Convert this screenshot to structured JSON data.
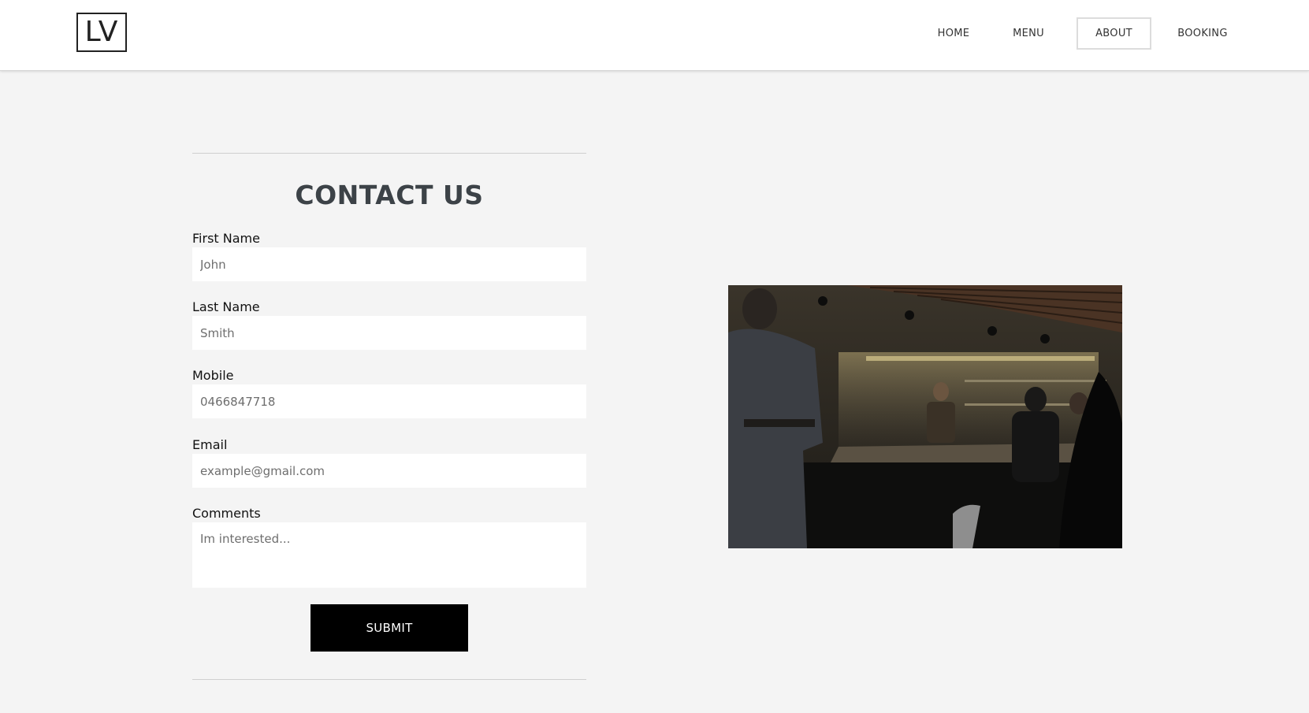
{
  "header": {
    "logo_text": "LV",
    "nav": [
      {
        "label": "HOME",
        "active": false
      },
      {
        "label": "MENU",
        "active": false
      },
      {
        "label": "ABOUT",
        "active": true
      },
      {
        "label": "BOOKING",
        "active": false
      }
    ]
  },
  "contact": {
    "title": "CONTACT US",
    "fields": [
      {
        "label": "First Name",
        "placeholder": "John",
        "value": ""
      },
      {
        "label": "Last Name",
        "placeholder": "Smith",
        "value": ""
      },
      {
        "label": "Mobile",
        "placeholder": "0466847718",
        "value": ""
      },
      {
        "label": "Email",
        "placeholder": "example@gmail.com",
        "value": ""
      },
      {
        "label": "Comments",
        "placeholder": "Im interested...",
        "value": ""
      }
    ],
    "submit_label": "SUBMIT"
  },
  "image": {
    "subject": "restaurant-kitchen-photo"
  },
  "colors": {
    "page_bg": "#f4f4f4",
    "header_bg": "#ffffff",
    "title": "#3c4247",
    "button_bg": "#000000",
    "button_text": "#ffffff"
  }
}
